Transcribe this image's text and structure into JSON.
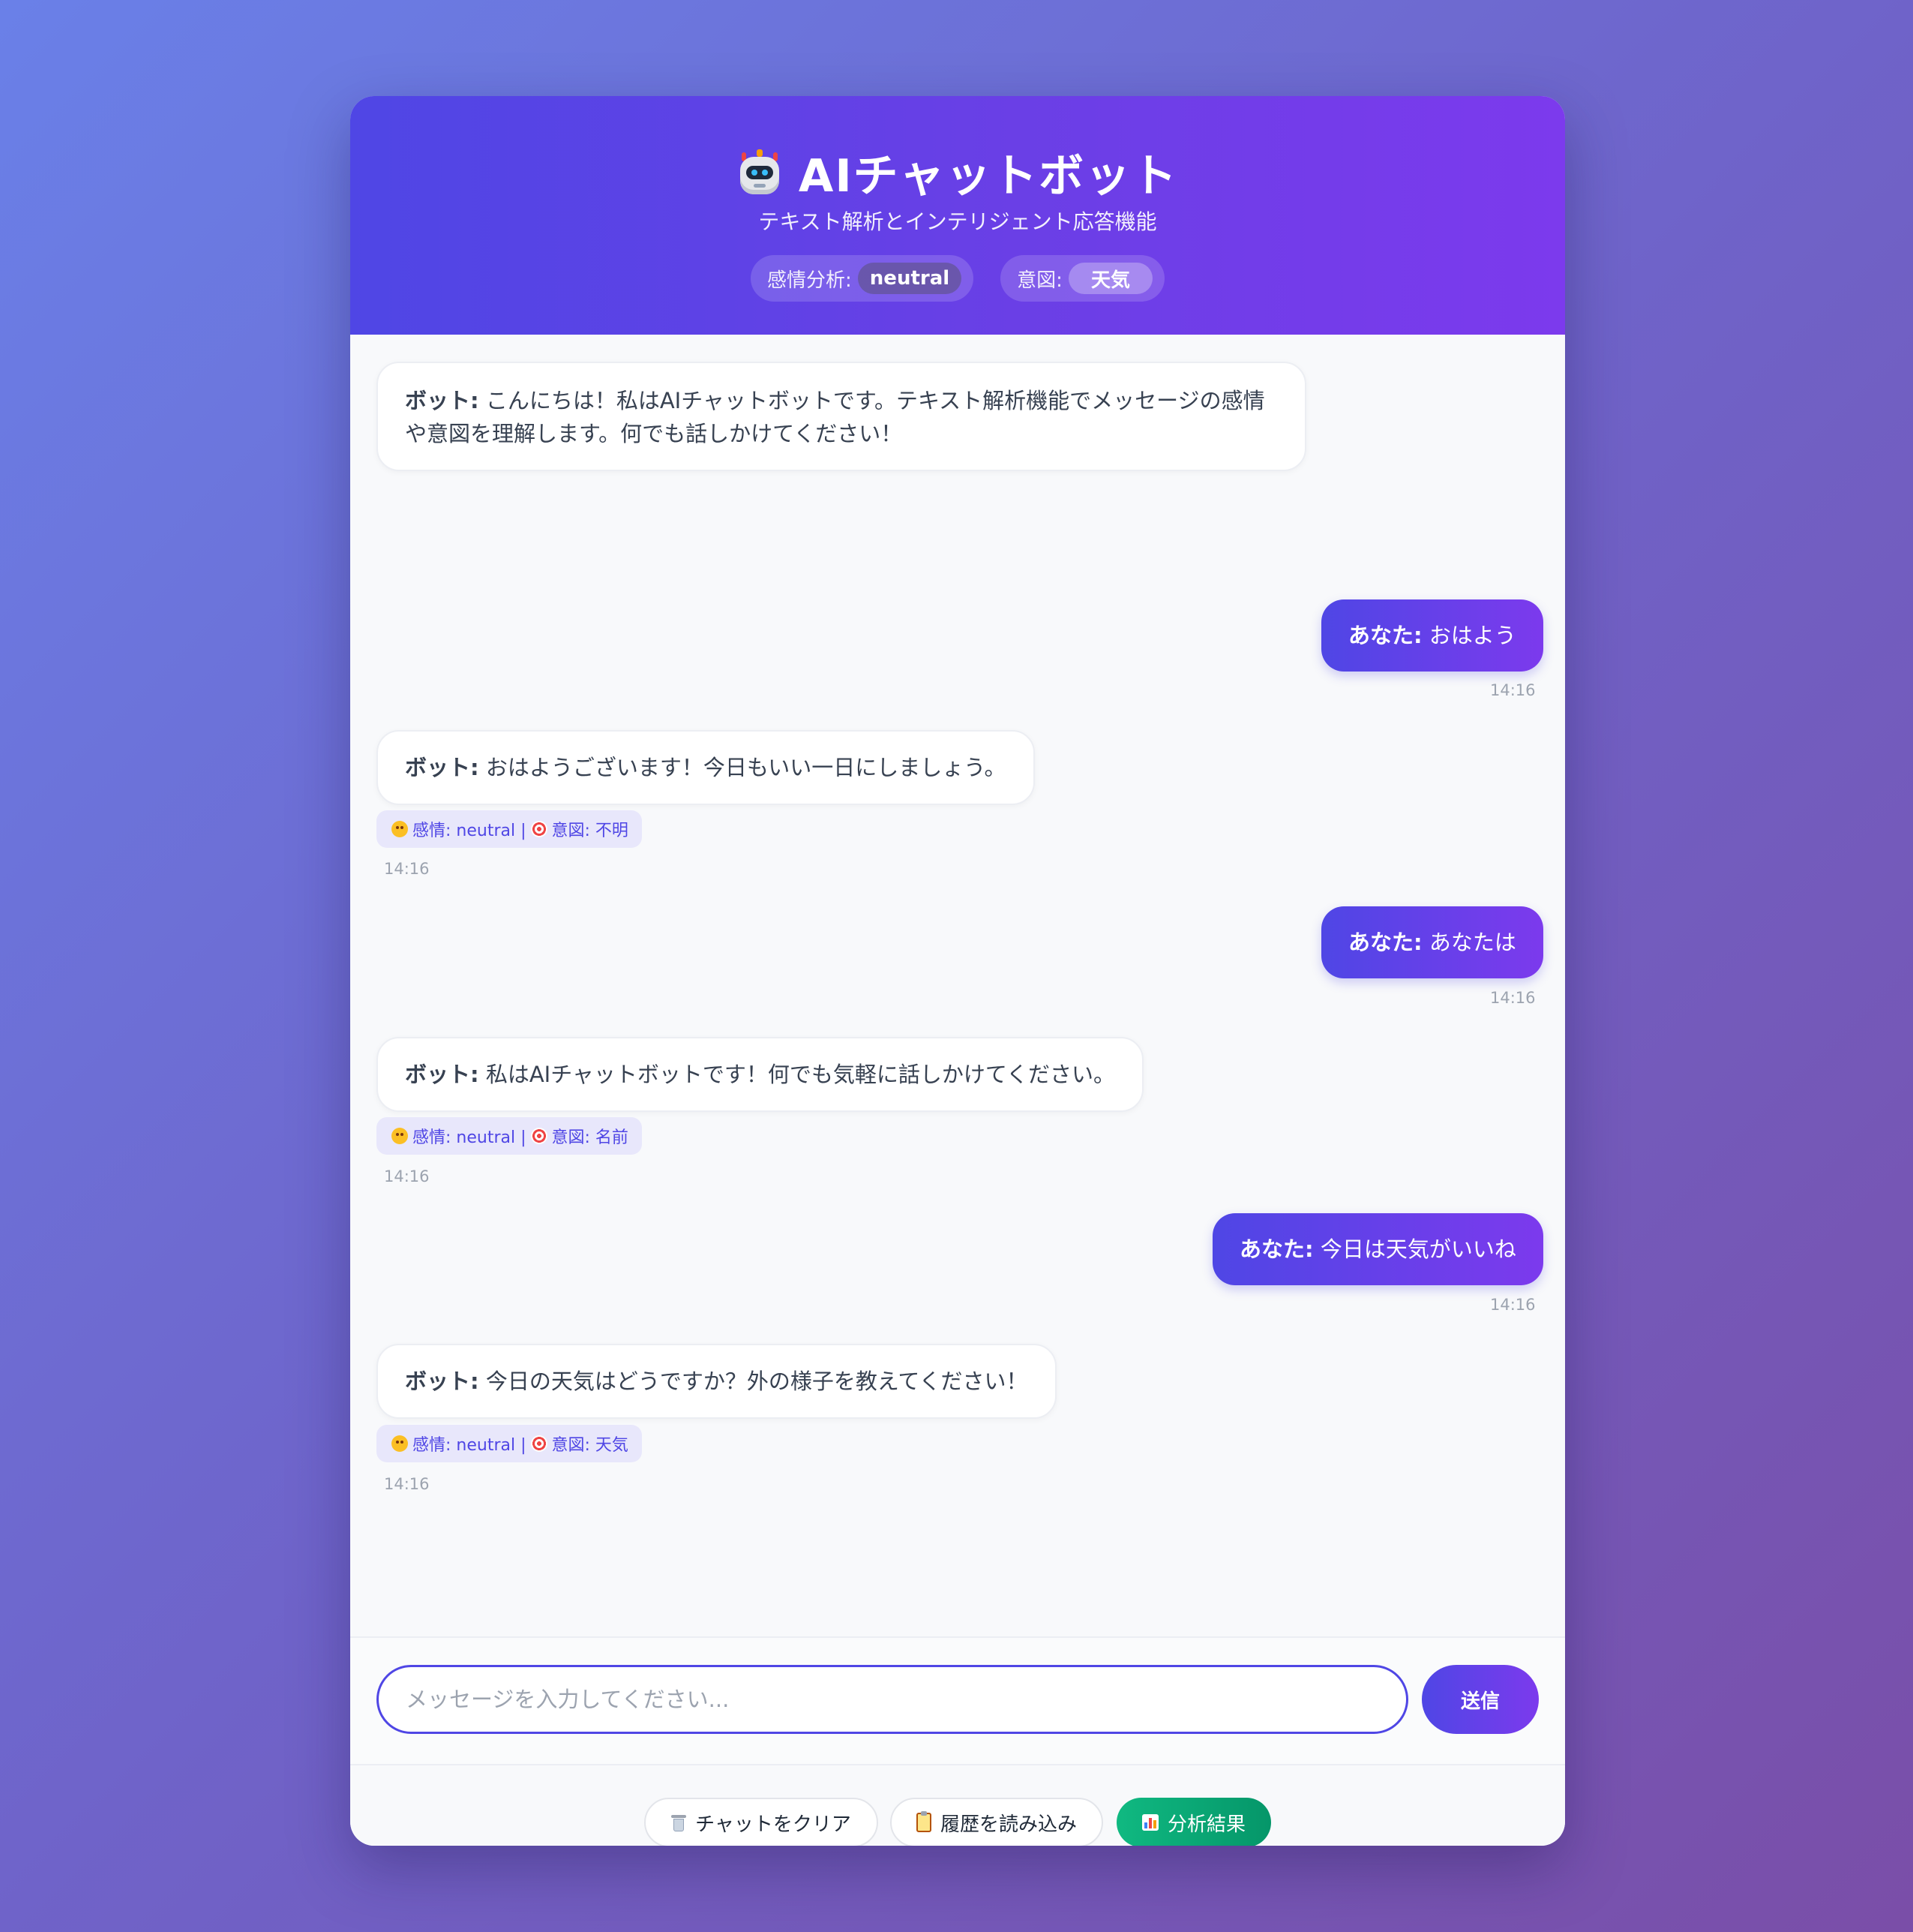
{
  "header": {
    "title": "AIチャットボット",
    "subtitle": "テキスト解析とインテリジェント応答機能",
    "sentiment_label": "感情分析:",
    "sentiment_value": "neutral",
    "intent_label": "意図:",
    "intent_value": "天気",
    "icon": "robot-icon"
  },
  "messages": [
    {
      "role": "bot",
      "who": "ボット:",
      "text": "こんにちは！私はAIチャットボットです。テキスト解析機能でメッセージの感情や意図を理解します。何でも話しかけてください！"
    },
    {
      "role": "user",
      "who": "あなた:",
      "text": "おはよう",
      "time": "14:16"
    },
    {
      "role": "bot",
      "who": "ボット:",
      "text": "おはようございます！今日もいい一日にしましょう。",
      "meta_sentiment": "感情: neutral |",
      "meta_intent": "意図: 不明",
      "time": "14:16"
    },
    {
      "role": "user",
      "who": "あなた:",
      "text": "あなたは",
      "time": "14:16"
    },
    {
      "role": "bot",
      "who": "ボット:",
      "text": "私はAIチャットボットです！何でも気軽に話しかけてください。",
      "meta_sentiment": "感情: neutral |",
      "meta_intent": "意図: 名前",
      "time": "14:16"
    },
    {
      "role": "user",
      "who": "あなた:",
      "text": "今日は天気がいいね",
      "time": "14:16"
    },
    {
      "role": "bot",
      "who": "ボット:",
      "text": "今日の天気はどうですか？外の様子を教えてください！",
      "meta_sentiment": "感情: neutral |",
      "meta_intent": "意図: 天気",
      "time": "14:16"
    }
  ],
  "input": {
    "placeholder": "メッセージを入力してください...",
    "value": "",
    "send_label": "送信"
  },
  "footer": {
    "clear_label": "チャットをクリア",
    "history_label": "履歴を読み込み",
    "analysis_label": "分析結果"
  },
  "colors": {
    "accent": "#4f46e5",
    "accent_end": "#7c3aed",
    "analysis_button": "#10b981"
  }
}
